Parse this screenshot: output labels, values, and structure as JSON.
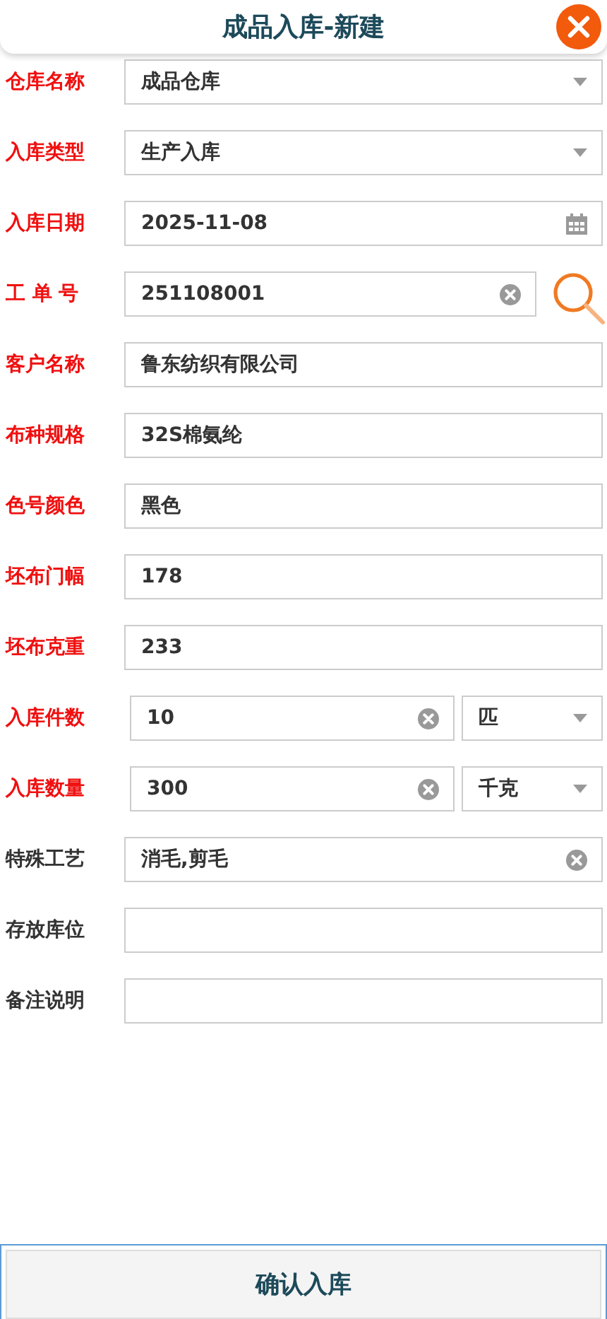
{
  "header": {
    "title": "成品入库-新建"
  },
  "fields": [
    {
      "label": "仓库名称",
      "required": true,
      "kind": "select",
      "value": "成品仓库"
    },
    {
      "label": "入库类型",
      "required": true,
      "kind": "select",
      "value": "生产入库"
    },
    {
      "label": "入库日期",
      "required": true,
      "kind": "date",
      "value": "2025-11-08"
    },
    {
      "label": "工 单 号",
      "required": true,
      "kind": "lookup",
      "value": "251108001"
    },
    {
      "label": "客户名称",
      "required": true,
      "kind": "text",
      "value": "鲁东纺织有限公司"
    },
    {
      "label": "布种规格",
      "required": true,
      "kind": "text",
      "value": "32S棉氨纶"
    },
    {
      "label": "色号颜色",
      "required": true,
      "kind": "text",
      "value": "黑色"
    },
    {
      "label": "坯布门幅",
      "required": true,
      "kind": "text",
      "value": "178"
    },
    {
      "label": "坯布克重",
      "required": true,
      "kind": "text",
      "value": "233"
    },
    {
      "label": "入库件数",
      "required": true,
      "kind": "quantity",
      "value": "10",
      "unit": "匹"
    },
    {
      "label": "入库数量",
      "required": true,
      "kind": "quantity",
      "value": "300",
      "unit": "千克"
    },
    {
      "label": "特殊工艺",
      "required": false,
      "kind": "clearable",
      "value": "消毛,剪毛"
    },
    {
      "label": "存放库位",
      "required": false,
      "kind": "text"
    },
    {
      "label": "备注说明",
      "required": false,
      "kind": "text"
    }
  ],
  "footer": {
    "button": "确认入库"
  }
}
